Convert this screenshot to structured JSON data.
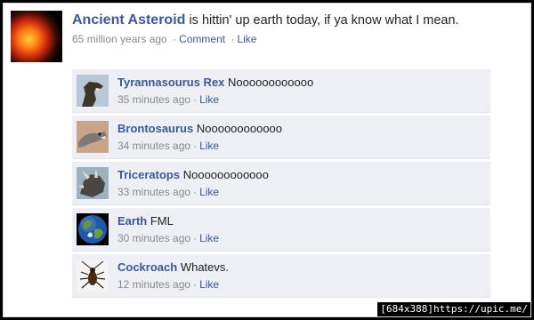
{
  "post": {
    "author": "Ancient Asteroid",
    "text": "is hittin' up earth today, if ya know what I mean.",
    "time": "65 million years ago",
    "comment_label": "Comment",
    "like_label": "Like",
    "separator": "·"
  },
  "comments": [
    {
      "name": "Tyrannasourus Rex",
      "text": "Noooooooooooo",
      "time": "35 minutes ago",
      "like": "Like",
      "icon": "t-rex-avatar-icon"
    },
    {
      "name": "Brontosaurus",
      "text": "Noooooooooooo",
      "time": "34 minutes ago",
      "like": "Like",
      "icon": "brontosaurus-avatar-icon"
    },
    {
      "name": "Triceratops",
      "text": "Noooooooooooo",
      "time": "33 minutes ago",
      "like": "Like",
      "icon": "triceratops-avatar-icon"
    },
    {
      "name": "Earth",
      "text": "FML",
      "time": "30 minutes ago",
      "like": "Like",
      "icon": "earth-globe-icon"
    },
    {
      "name": "Cockroach",
      "text": "Whatevs.",
      "time": "12 minutes ago",
      "like": "Like",
      "icon": "cockroach-icon"
    }
  ],
  "watermark": "[684x388]https://upic.me/",
  "colors": {
    "link": "#3b5998",
    "comment_bg": "#edeff4",
    "meta": "#8a8a8a"
  }
}
